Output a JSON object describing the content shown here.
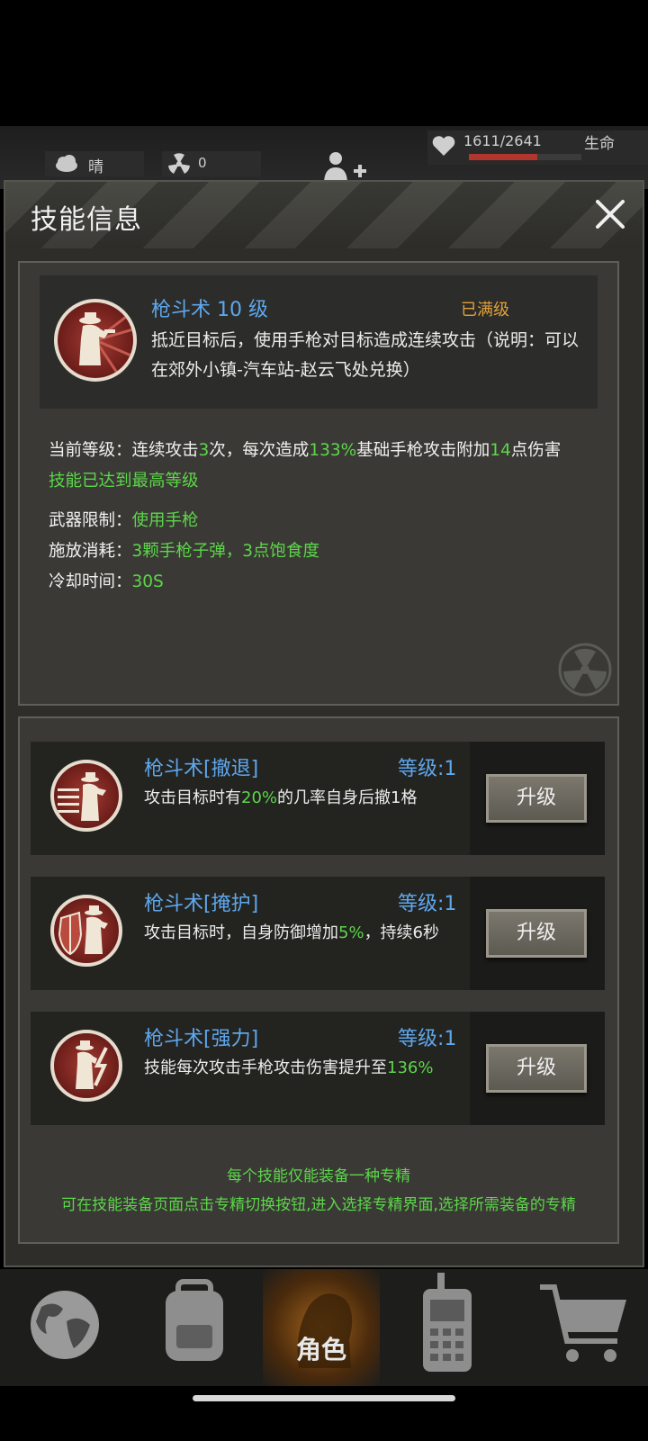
{
  "status": {
    "weather": "晴",
    "radiation": "0",
    "hp": "1611/2641",
    "hp_label": "生命",
    "hp_fraction": 0.61
  },
  "dialog": {
    "title": "技能信息",
    "skill": {
      "name": "枪斗术 10 级",
      "status": "已满级",
      "description": "抵近目标后，使用手枪对目标造成连续攻击（说明：可以在郊外小镇-汽车站-赵云飞处兑换）"
    },
    "details": {
      "current_prefix": "当前等级：连续攻击",
      "current_hits": "3",
      "current_mid1": "次，每次造成",
      "current_pct": "133%",
      "current_mid2": "基础手枪攻击附加",
      "current_bonus": "14",
      "current_suffix": "点伤害",
      "max_text": "技能已达到最高等级",
      "weapon_label": "武器限制：",
      "weapon_value": "使用手枪",
      "cost_label": "施放消耗：",
      "cost_value": "3颗手枪子弹，3点饱食度",
      "cooldown_label": "冷却时间：",
      "cooldown_value": "30S"
    },
    "specializations": [
      {
        "name": "枪斗术[撤退]",
        "level": "等级:1",
        "desc_prefix": "攻击目标时有",
        "desc_value": "20%",
        "desc_suffix": "的几率自身后撤1格",
        "button": "升级"
      },
      {
        "name": "枪斗术[掩护]",
        "level": "等级:1",
        "desc_prefix": "攻击目标时，自身防御增加",
        "desc_value": "5%",
        "desc_suffix": "，持续6秒",
        "button": "升级"
      },
      {
        "name": "枪斗术[强力]",
        "level": "等级:1",
        "desc_prefix": "技能每次攻击手枪攻击伤害提升至",
        "desc_value": "136%",
        "desc_suffix": "",
        "button": "升级"
      }
    ],
    "notes": [
      "每个技能仅能装备一种专精",
      "可在技能装备页面点击专精切换按钮,进入选择专精界面,选择所需装备的专精"
    ]
  },
  "nav": {
    "active_label": "角色"
  },
  "colors": {
    "accent_blue": "#5ea7ec",
    "accent_green": "#5cd64a",
    "accent_orange": "#e0a13a"
  }
}
